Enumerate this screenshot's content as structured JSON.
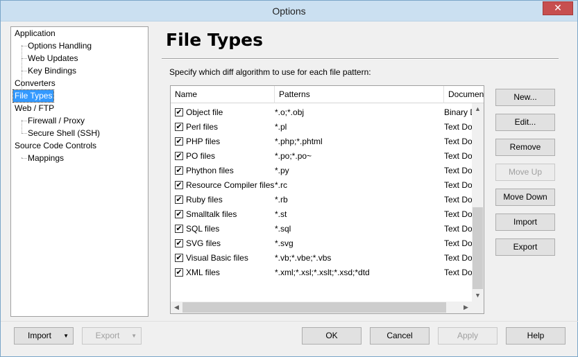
{
  "window": {
    "title": "Options",
    "close_symbol": "✕"
  },
  "tree": {
    "items": [
      {
        "label": "Application",
        "level": 0
      },
      {
        "label": "Options Handling",
        "level": 1
      },
      {
        "label": "Web Updates",
        "level": 1
      },
      {
        "label": "Key Bindings",
        "level": 1
      },
      {
        "label": "Converters",
        "level": 0
      },
      {
        "label": "File Types",
        "level": 0,
        "selected": true
      },
      {
        "label": "Web / FTP",
        "level": 0
      },
      {
        "label": "Firewall / Proxy",
        "level": 1
      },
      {
        "label": "Secure Shell (SSH)",
        "level": 1
      },
      {
        "label": "Source Code Controls",
        "level": 0
      },
      {
        "label": "Mappings",
        "level": 1
      }
    ]
  },
  "page": {
    "title": "File Types",
    "description": "Specify which diff algorithm to use for each file pattern:"
  },
  "list": {
    "columns": [
      "Name",
      "Patterns",
      "Documen"
    ],
    "rows": [
      {
        "checked": true,
        "name": "Object file",
        "patterns": "*.o;*.obj",
        "doc": "Binary D"
      },
      {
        "checked": true,
        "name": "Perl files",
        "patterns": "*.pl",
        "doc": "Text Do"
      },
      {
        "checked": true,
        "name": "PHP files",
        "patterns": "*.php;*.phtml",
        "doc": "Text Do"
      },
      {
        "checked": true,
        "name": "PO files",
        "patterns": "*.po;*.po~",
        "doc": "Text Do"
      },
      {
        "checked": true,
        "name": "Phython files",
        "patterns": "*.py",
        "doc": "Text Do"
      },
      {
        "checked": true,
        "name": "Resource Compiler files",
        "patterns": "*.rc",
        "doc": "Text Do"
      },
      {
        "checked": true,
        "name": "Ruby files",
        "patterns": "*.rb",
        "doc": "Text Do"
      },
      {
        "checked": true,
        "name": "Smalltalk files",
        "patterns": "*.st",
        "doc": "Text Do"
      },
      {
        "checked": true,
        "name": "SQL files",
        "patterns": "*.sql",
        "doc": "Text Do"
      },
      {
        "checked": true,
        "name": "SVG files",
        "patterns": "*.svg",
        "doc": "Text Do"
      },
      {
        "checked": true,
        "name": "Visual Basic files",
        "patterns": "*.vb;*.vbe;*.vbs",
        "doc": "Text Do"
      },
      {
        "checked": true,
        "name": "XML files",
        "patterns": "*.xml;*.xsl;*.xslt;*.xsd;*dtd",
        "doc": "Text Do"
      }
    ]
  },
  "side_buttons": {
    "new": "New...",
    "edit": "Edit...",
    "remove": "Remove",
    "move_up": "Move Up",
    "move_down": "Move Down",
    "import": "Import",
    "export": "Export"
  },
  "footer": {
    "import": "Import",
    "export": "Export",
    "ok": "OK",
    "cancel": "Cancel",
    "apply": "Apply",
    "help": "Help"
  },
  "icons": {
    "check": "✔",
    "dropdown": "▼",
    "scroll_up": "▲",
    "scroll_down": "▼",
    "scroll_left": "◀",
    "scroll_right": "▶"
  },
  "colors": {
    "selection": "#3399ff",
    "titlebar": "#cbe0f1",
    "close": "#c74f4f"
  }
}
